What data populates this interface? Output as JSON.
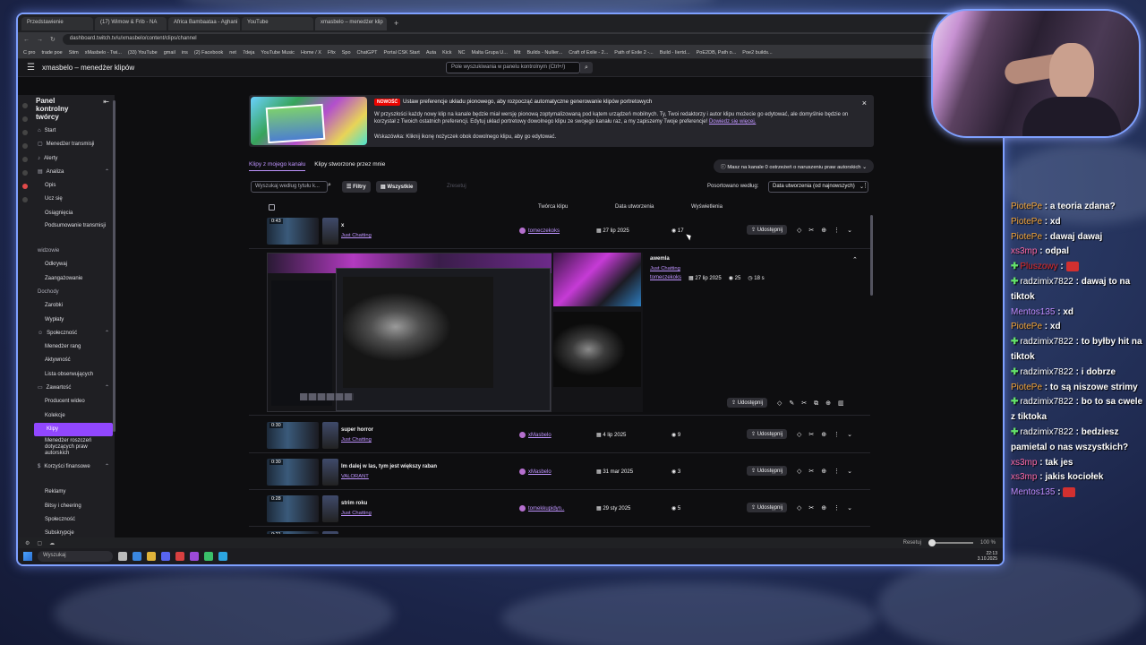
{
  "browser": {
    "tabs": [
      "Przedstawienie",
      "(17) Wimow & Frib - NA",
      "Africa Bambaataa - Aghani",
      "YouTube",
      "xmasbelo – menedżer klip"
    ],
    "url": "dashboard.twitch.tv/u/xmasbelo/content/clips/channel",
    "bookmarks": [
      "C pro",
      "trade poe",
      "Stim",
      "xMasbelo - Twi...",
      "(33) YouTube",
      "gmail",
      "ins",
      "(2) Facebook",
      "net",
      "7deja",
      "YouTube Music",
      "Home / X",
      "Ffix",
      "Spo",
      "ChatGPT",
      "Portal CSK Start",
      "Auta",
      "Kick",
      "NC",
      "Malta Grupa U...",
      "Mtt",
      "Builds - Nullier...",
      "Craft of Exile - 2...",
      "Path of Exile 2 -...",
      "Build - Iiertd...",
      "PoE2DB, Path o...",
      "Poe2 builds..."
    ]
  },
  "twitch_header": {
    "title": "xmasbelo – menedżer klipów",
    "search_placeholder": "Pole wyszukiwania w panelu kontrolnym (Ctrl+/)"
  },
  "sidebar": {
    "heading": "Panel kontrolny twórcy",
    "items": [
      {
        "label": "Start",
        "kind": "sec",
        "icon": "⌂"
      },
      {
        "label": "Menedżer transmisji",
        "kind": "sec",
        "icon": "▢"
      },
      {
        "label": "Alerty",
        "kind": "sec",
        "icon": "♪"
      },
      {
        "label": "Analiza",
        "kind": "sec",
        "icon": "▤",
        "chev": "⌃"
      },
      {
        "label": "Opis",
        "kind": "sub"
      },
      {
        "label": "Ucz się",
        "kind": "sub"
      },
      {
        "label": "Osiągnięcia",
        "kind": "sub"
      },
      {
        "label": "Podsumowanie transmisji",
        "kind": "sub two"
      },
      {
        "label": "widzowie",
        "kind": "cat"
      },
      {
        "label": "Odkrywaj",
        "kind": "sub"
      },
      {
        "label": "Zaangażowanie",
        "kind": "sub"
      },
      {
        "label": "Dochody",
        "kind": "cat"
      },
      {
        "label": "Zarobki",
        "kind": "sub"
      },
      {
        "label": "Wypłaty",
        "kind": "sub"
      },
      {
        "label": "Społeczność",
        "kind": "sec",
        "icon": "☺",
        "chev": "⌃"
      },
      {
        "label": "Menedżer rang",
        "kind": "sub"
      },
      {
        "label": "Aktywność",
        "kind": "sub"
      },
      {
        "label": "Lista obserwujących",
        "kind": "sub"
      },
      {
        "label": "Zawartość",
        "kind": "sec",
        "icon": "▭",
        "chev": "⌃"
      },
      {
        "label": "Producent wideo",
        "kind": "sub"
      },
      {
        "label": "Kolekcje",
        "kind": "sub"
      },
      {
        "label": "Klipy",
        "kind": "sub active"
      },
      {
        "label": "Menedżer roszczeń dotyczących praw autorskich",
        "kind": "sub three"
      },
      {
        "label": "Korzyści finansowe",
        "kind": "sec two",
        "icon": "$",
        "chev": "⌃"
      },
      {
        "label": "Reklamy",
        "kind": "sub"
      },
      {
        "label": "Bitsy i cheering",
        "kind": "sub"
      },
      {
        "label": "Społeczność",
        "kind": "sub"
      },
      {
        "label": "Subskrypcje",
        "kind": "sub"
      },
      {
        "label": "Umowy sponsorskie",
        "kind": "sub"
      },
      {
        "label": "Partner",
        "kind": "sub"
      }
    ]
  },
  "banner": {
    "badge": "NOWOŚĆ",
    "headline": "Ustaw preferencje układu pionowego, aby rozpocząć automatyczne generowanie klipów portretowych",
    "body": "W przyszłości każdy nowy klip na kanale będzie miał wersję pionową zoptymalizowaną pod kątem urządzeń mobilnych. Ty, Twoi redaktorzy i autor klipu możecie go edytować, ale domyślnie będzie on korzystał z Twoich ostatnich preferencji. Edytuj układ portretowy dowolnego klipu ze swojego kanału raz, a my zapiszemy Twoje preferencje!",
    "link": "Dowiedz się więcej.",
    "tip": "Wskazówka: Kliknij ikonę nożyczek obok dowolnego klipu, aby go edytować."
  },
  "clip_tabs": [
    "Klipy z mojego kanału",
    "Klipy stworzone przez mnie"
  ],
  "copyright_notice": "Masz na kanale 0 ostrzeżeń o naruszeniu praw autorskich",
  "toolbar": {
    "search_placeholder": "Wyszukaj według tytułu k...",
    "filters": "Filtry",
    "all": "Wszystkie",
    "reset": "Zresetuj",
    "sort_label": "Posortowano według:",
    "sort_value": "Data utworzenia (od najnowszych)"
  },
  "table_headers": {
    "creator": "Twórca klipu",
    "date": "Data utworzenia",
    "views": "Wyświetlenia"
  },
  "share_label": "Udostępnij",
  "clips": [
    {
      "duration": "0:43",
      "title": "x",
      "category": "Just Chatting",
      "creator": "tomeczekoks",
      "date": "27 lip 2025",
      "views": "17"
    },
    {
      "duration": "0:30",
      "title": "super horror",
      "category": "Just Chatting",
      "creator": "xMasbelo",
      "date": "4 lip 2025",
      "views": "9"
    },
    {
      "duration": "0:30",
      "title": "Im dalej w las, tym jest większy raban",
      "category": "VALORANT",
      "creator": "xMasbelo",
      "date": "31 mar 2025",
      "views": "3"
    },
    {
      "duration": "0:28",
      "title": "strim roku",
      "category": "Just Chatting",
      "creator": "tomekkupidyn..",
      "date": "29 sty 2025",
      "views": "5"
    },
    {
      "duration": "0:21",
      "title": "",
      "category": "",
      "creator": "",
      "date": "",
      "views": ""
    }
  ],
  "expanded_clip": {
    "title": "awemla",
    "category": "Just Chatting",
    "creator": "tomeczekoks",
    "date": "27 lip 2025",
    "views": "25",
    "length": "18 s"
  },
  "statusbar": {
    "zoom_label": "Resetuj",
    "zoom": "100 %"
  },
  "taskbar": {
    "search": "Wyszukaj",
    "time": "22:13",
    "date": "3.10.2025"
  },
  "chat": [
    {
      "user": "PiotePe",
      "color": "#f5a63a",
      "text": "a teoria zdana?"
    },
    {
      "user": "PiotePe",
      "color": "#f5a63a",
      "text": "xd"
    },
    {
      "user": "PiotePe",
      "color": "#f5a63a",
      "text": "dawaj dawaj"
    },
    {
      "user": "xs3mp",
      "color": "#ff6aa8",
      "text": "odpal"
    },
    {
      "user": "Pluszowy",
      "color": "#e02828",
      "text": "",
      "gem": true,
      "emote": true
    },
    {
      "user": "radzimix7822",
      "color": "#ffffff",
      "text": "dawaj to na tiktok",
      "gem": true
    },
    {
      "user": "Mentos135",
      "color": "#c08cff",
      "text": "xd"
    },
    {
      "user": "PiotePe",
      "color": "#f5a63a",
      "text": "xd"
    },
    {
      "user": "radzimix7822",
      "color": "#ffffff",
      "text": "to byłby hit na tiktok",
      "gem": true
    },
    {
      "user": "radzimix7822",
      "color": "#ffffff",
      "text": "i dobrze",
      "gem": true
    },
    {
      "user": "PiotePe",
      "color": "#f5a63a",
      "text": "to są niszowe strimy"
    },
    {
      "user": "radzimix7822",
      "color": "#ffffff",
      "text": "bo to sa cwele z tiktoka",
      "gem": true
    },
    {
      "user": "radzimix7822",
      "color": "#ffffff",
      "text": "bedziesz pamietal o nas wszystkich?",
      "gem": true
    },
    {
      "user": "xs3mp",
      "color": "#ff6aa8",
      "text": "tak jes"
    },
    {
      "user": "xs3mp",
      "color": "#ff6aa8",
      "text": "jakis kociołek"
    },
    {
      "user": "Mentos135",
      "color": "#c08cff",
      "text": "",
      "emote": true
    }
  ]
}
